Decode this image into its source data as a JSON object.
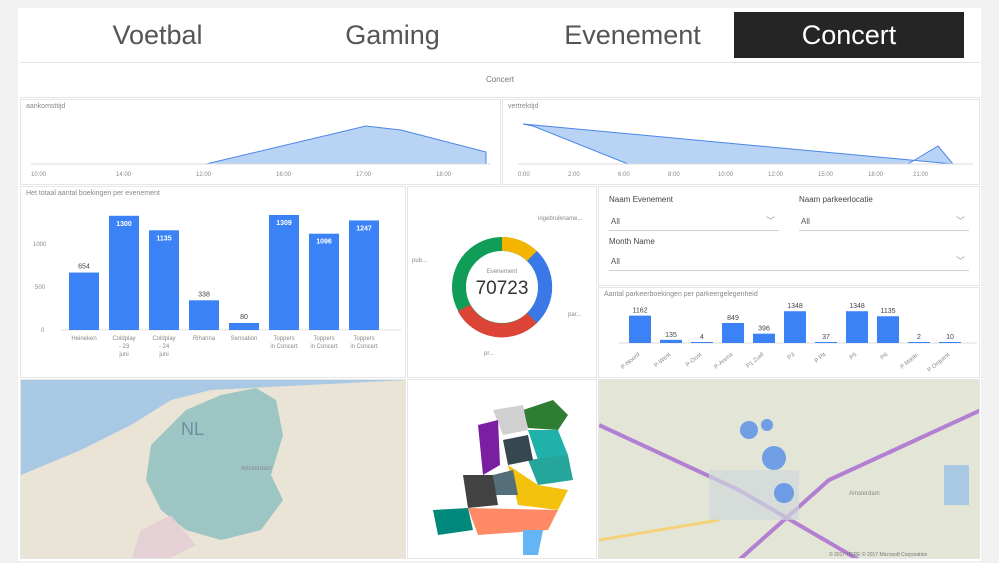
{
  "tabs": [
    {
      "label": "Voetbal",
      "active": false
    },
    {
      "label": "Gaming",
      "active": false
    },
    {
      "label": "Evenement",
      "active": false
    },
    {
      "label": "Concert",
      "active": true
    }
  ],
  "subtitle": "Concert",
  "area_left": {
    "title": "aankomsttijd",
    "ticks": [
      "10:00",
      "14:00",
      "12:00",
      "16:00",
      "17:00",
      "18:00"
    ]
  },
  "area_right": {
    "title": "vertrektijd",
    "ticks": [
      "0:00",
      "2:00",
      "6:00",
      "8:00",
      "10:00",
      "12:00",
      "15:00",
      "18:00",
      "21:00"
    ]
  },
  "bar_panel": {
    "title": "Het totaal aantal boekingen per evenement",
    "y_ticks": [
      "1000",
      "500",
      "0"
    ]
  },
  "chart_data": {
    "type": "bar",
    "categories": [
      "Heineken",
      "Coldplay - 23 juni",
      "Coldplay - 24 juni",
      "Rihanna",
      "Sensation",
      "Toppers in Concert",
      "Toppers in Concert",
      "Toppers in Concert"
    ],
    "values": [
      654,
      1300,
      1135,
      338,
      80,
      1309,
      1096,
      1247
    ],
    "ylim": [
      0,
      1400
    ]
  },
  "donut": {
    "center_label": "Evenement",
    "total": "70723",
    "legend_top": "ingebruikname...",
    "legend_left": "pub...",
    "legend_right": "par...",
    "legend_bottom": "pr..."
  },
  "slicers": {
    "evenement_label": "Naam Evenement",
    "evenement_value": "All",
    "parkeerlocatie_label": "Naam parkeerlocatie",
    "parkeerlocatie_value": "All",
    "month_label": "Month Name",
    "month_value": "All"
  },
  "small_bars": {
    "title": "Aantal parkeerboekingen per parkeergelegenheid",
    "values_text": [
      "1162",
      "135",
      "4",
      "849",
      "396",
      "1348",
      "37",
      "1348",
      "1135",
      "2",
      "10"
    ],
    "values": [
      1162,
      135,
      4,
      849,
      396,
      1348,
      37,
      1348,
      1135,
      2,
      10
    ],
    "categories": [
      "P-Noord",
      "P-West",
      "P-Oost",
      "P-Arena",
      "P1 Zuid",
      "P3",
      "P Pit",
      "P5",
      "P6",
      "P Mastr.",
      "P Orquest"
    ]
  },
  "maps": {
    "left_label": "NL",
    "left_watermark": "",
    "nl_city": "Amsterdam",
    "right_label": "Amsterdam",
    "right_copyright": "© 2017 HERE   © 2017 Microsoft Corporation"
  },
  "colors": {
    "accent": "#3b82f6",
    "donut": [
      "#f4b400",
      "#3b78e7",
      "#db4437",
      "#0f9d58"
    ]
  }
}
